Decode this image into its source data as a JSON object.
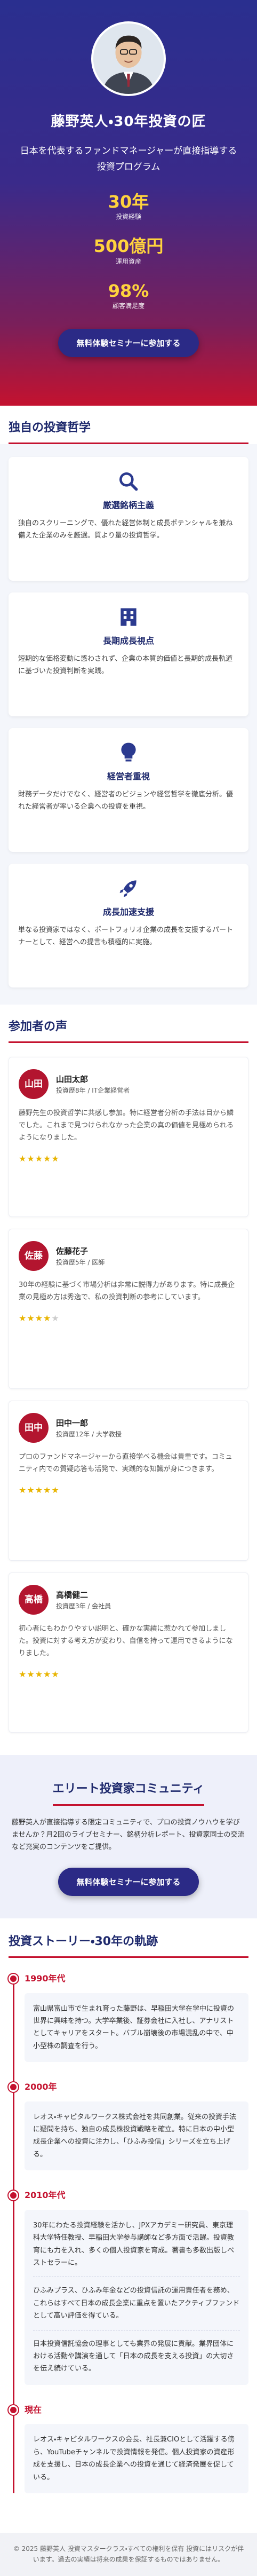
{
  "hero": {
    "name_title": "藤野英人・30年投資の匠",
    "lead": "日本を代表するファンドマネージャーが直接指導する投資プログラム",
    "stats": [
      {
        "value": "30年",
        "label": "投資経験"
      },
      {
        "value": "500億円",
        "label": "運用資産"
      },
      {
        "value": "98%",
        "label": "顧客満足度"
      }
    ],
    "cta_label": "無料体験セミナーに参加する"
  },
  "philosophy": {
    "title": "独自の投資哲学",
    "cards": [
      {
        "icon": "search-icon",
        "title": "厳選銘柄主義",
        "text": "独自のスクリーニングで、優れた経営体制と成長ポテンシャルを兼ね備えた企業のみを厳選。質より量の投資哲学。"
      },
      {
        "icon": "building-icon",
        "title": "長期成長視点",
        "text": "短期的な価格変動に惑わされず、企業の本質的価値と長期的成長軌道に基づいた投資判断を実践。"
      },
      {
        "icon": "bulb-icon",
        "title": "経営者重視",
        "text": "財務データだけでなく、経営者のビジョンや経営哲学を徹底分析。優れた経営者が率いる企業への投資を重視。"
      },
      {
        "icon": "rocket-icon",
        "title": "成長加速支援",
        "text": "単なる投資家ではなく、ポートフォリオ企業の成長を支援するパートナーとして、経営への提言も積極的に実施。"
      }
    ]
  },
  "voices": {
    "title": "参加者の声",
    "items": [
      {
        "badge": "山田",
        "name": "山田太郎",
        "role": "投資歴8年 / IT企業経営者",
        "text": "藤野先生の投資哲学に共感し参加。特に経営者分析の手法は目から鱗でした。これまで見つけられなかった企業の真の価値を見極められるようになりました。",
        "stars": "★★★★★",
        "stars_off": ""
      },
      {
        "badge": "佐藤",
        "name": "佐藤花子",
        "role": "投資歴5年 / 医師",
        "text": "30年の経験に基づく市場分析は非常に説得力があります。特に成長企業の見極め方は秀逸で、私の投資判断の参考にしています。",
        "stars": "★★★★",
        "stars_off": "★"
      },
      {
        "badge": "田中",
        "name": "田中一郎",
        "role": "投資歴12年 / 大学教授",
        "text": "プロのファンドマネージャーから直接学べる機会は貴重です。コミュニティ内での質疑応答も活発で、実践的な知識が身につきます。",
        "stars": "★★★★★",
        "stars_off": ""
      },
      {
        "badge": "高橋",
        "name": "高橋健二",
        "role": "投資歴3年 / 会社員",
        "text": "初心者にもわかりやすい説明と、確かな実績に惹かれて参加しました。投資に対する考え方が変わり、自信を持って運用できるようになりました。",
        "stars": "★★★★★",
        "stars_off": ""
      }
    ]
  },
  "community": {
    "title": "エリート投資家コミュニティ",
    "text": "藤野英人が直接指導する限定コミュニティで、プロの投資ノウハウを学びませんか？月2回のライブセミナー、銘柄分析レポート、投資家同士の交流など充実のコンテンツをご提供。",
    "cta_label": "無料体験セミナーに参加する"
  },
  "story": {
    "title": "投資ストーリー・30年の軌跡",
    "items": [
      {
        "year": "1990年代",
        "paragraphs": [
          "富山県富山市で生まれ育った藤野は、早稲田大学在学中に投資の世界に興味を持つ。大学卒業後、証券会社に入社し、アナリストとしてキャリアをスタート。バブル崩壊後の市場混乱の中で、中小型株の調査を行う。"
        ]
      },
      {
        "year": "2000年",
        "paragraphs": [
          "レオス・キャピタルワークス株式会社を共同創業。従来の投資手法に疑問を持ち、独自の成長株投資戦略を確立。特に日本の中小型成長企業への投資に注力し、「ひふみ投信」シリーズを立ち上げる。"
        ]
      },
      {
        "year": "2010年代",
        "paragraphs": [
          "30年にわたる投資経験を活かし、JPXアカデミー研究員、東京理科大学特任教授、早稲田大学参与講師など多方面で活躍。投資教育にも力を入れ、多くの個人投資家を育成。著書も多数出版しベストセラーに。",
          "ひふみプラス、ひふみ年金などの投資信託の運用責任者を務め、これらはすべて日本の成長企業に重点を置いたアクティブファンドとして高い評価を得ている。",
          "日本投資信託協会の理事としても業界の発展に貢献。業界団体における活動や講演を通して「日本の成長を支える投資」の大切さを伝え続けている。"
        ]
      },
      {
        "year": "現在",
        "paragraphs": [
          "レオス・キャピタルワークスの会長、社長兼CIOとして活躍する傍ら、YouTubeチャンネルで投資情報を発信。個人投資家の資産形成を支援し、日本の成長企業への投資を通じて経済発展を促している。"
        ]
      }
    ]
  },
  "footer": {
    "text": "© 2025 藤野英人 投資マスタークラス・すべての権利を保有 投資にはリスクが伴います。過去の実績は将来の成果を保証するものではありません。"
  }
}
